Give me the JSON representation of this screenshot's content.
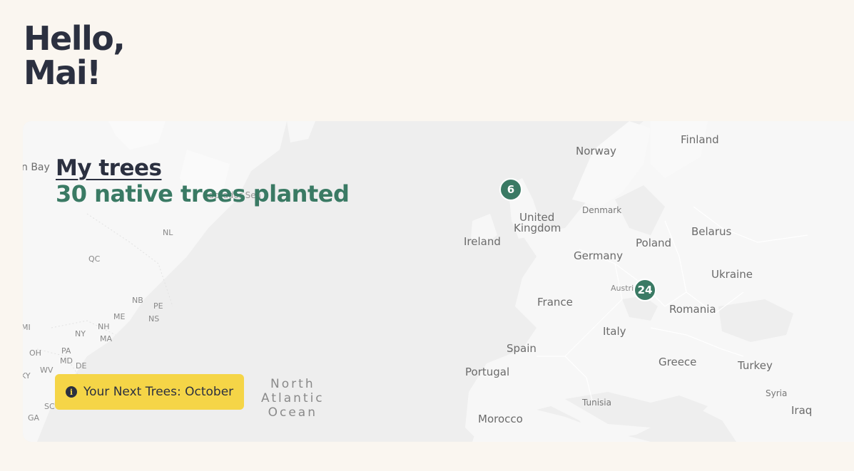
{
  "greeting": {
    "line1": "Hello,",
    "line2": "Mai!"
  },
  "trees": {
    "title": "My trees",
    "count": "30 native trees planted"
  },
  "markers": [
    {
      "label": "6",
      "region": "United Kingdom"
    },
    {
      "label": "24",
      "region": "Austria"
    }
  ],
  "next_trees": {
    "icon": "info-icon",
    "label": "Your Next Trees: October"
  },
  "map_labels": {
    "norway": "Norway",
    "finland": "Finland",
    "denmark": "Denmark",
    "united_kingdom_1": "United",
    "united_kingdom_2": "Kingdom",
    "ireland": "Ireland",
    "poland": "Poland",
    "belarus": "Belarus",
    "germany": "Germany",
    "ukraine": "Ukraine",
    "austria": "Austri",
    "france": "France",
    "romania": "Romania",
    "italy": "Italy",
    "spain": "Spain",
    "portugal": "Portugal",
    "greece": "Greece",
    "turkey": "Turkey",
    "syria": "Syria",
    "iraq": "Iraq",
    "tunisia": "Tunisia",
    "morocco": "Morocco",
    "ocean_1": "North",
    "ocean_2": "Atlantic",
    "ocean_3": "Ocean",
    "bay": "n Bay",
    "labrador": "Labrador Sea",
    "nl": "NL",
    "qc": "QC",
    "nb": "NB",
    "pe": "PE",
    "ns": "NS",
    "me": "ME",
    "ny": "NY",
    "nh": "NH",
    "ma": "MA",
    "mi": "MI",
    "oh": "OH",
    "pa": "PA",
    "md": "MD",
    "de": "DE",
    "wv": "WV",
    "ky": "KY",
    "sc": "SC",
    "ga": "GA"
  },
  "colors": {
    "accent": "#3a7a64",
    "badge": "#f5d547",
    "text": "#2b3040",
    "background": "#faf6f0"
  }
}
